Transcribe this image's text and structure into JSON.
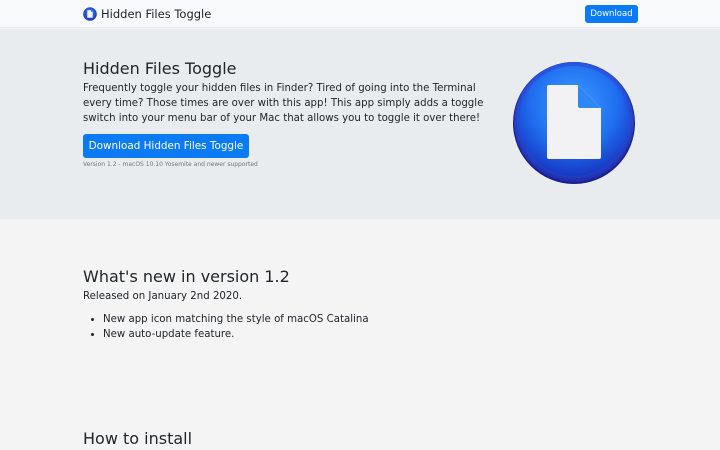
{
  "navbar": {
    "brand_name": "Hidden Files Toggle",
    "download_label": "Download"
  },
  "hero": {
    "title": "Hidden Files Toggle",
    "description": "Frequently toggle your hidden files in Finder? Tired of going into the Terminal every time? Those times are over with this app! This app simply adds a toggle switch into your menu bar of your Mac that allows you to toggle it over there!",
    "button_label": "Download Hidden Files Toggle",
    "version_note": "Version 1.2 - macOS 10.10 Yosemite and newer supported",
    "app_icon": "document-icon"
  },
  "whats_new": {
    "title": "What's new in version 1.2",
    "released": "Released on January 2nd 2020.",
    "changes": [
      "New app icon matching the style of macOS Catalina",
      "New auto-update feature."
    ]
  },
  "install": {
    "title": "How to install"
  },
  "colors": {
    "primary": "#0a7bf5",
    "hero_bg": "#e9ecef",
    "page_bg": "#f4f4f5",
    "navbar_bg": "#f8f9fa",
    "icon_blue": "#1a4fd8"
  }
}
